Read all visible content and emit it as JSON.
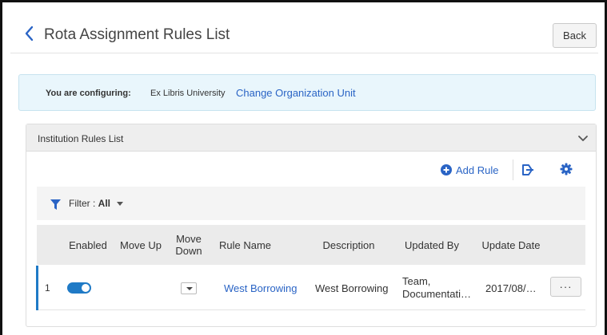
{
  "header": {
    "title": "Rota Assignment Rules List",
    "back_label": "Back"
  },
  "config": {
    "label": "You are configuring:",
    "org_name": "Ex Libris University",
    "change_link": "Change Organization Unit"
  },
  "panel": {
    "title": "Institution Rules List"
  },
  "toolbar": {
    "add_rule_label": "Add Rule"
  },
  "filter": {
    "label": "Filter : ",
    "value": "All"
  },
  "table": {
    "columns": [
      "Enabled",
      "Move Up",
      "Move Down",
      "Rule Name",
      "Description",
      "Updated By",
      "Update Date"
    ],
    "rows": [
      {
        "index": "1",
        "enabled": true,
        "rule_name": "West Borrowing",
        "description": "West Borrowing",
        "updated_by": "Team, Documentati…",
        "update_date": "2017/08/…",
        "more": "···"
      }
    ]
  },
  "colors": {
    "accent": "#1f7ac6",
    "link": "#2a64c5",
    "config_bg": "#e9f6fc"
  }
}
